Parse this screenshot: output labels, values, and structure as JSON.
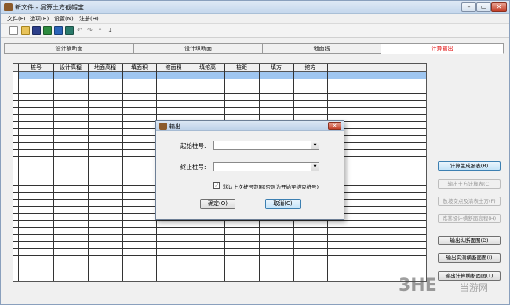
{
  "window": {
    "title": "新文件 - 易算土方截帽宝"
  },
  "menu": [
    {
      "label": "文件(F)"
    },
    {
      "label": "选项(B)"
    },
    {
      "label": "设置(N)"
    },
    {
      "label": "注册(H)"
    }
  ],
  "toolbar": {
    "icons": [
      "new-file-icon",
      "open-folder-icon",
      "save-icon",
      "excel-icon",
      "word-icon",
      "calculator-icon",
      "undo-icon",
      "redo-icon",
      "move-up-icon",
      "move-down-icon"
    ]
  },
  "tabs": [
    {
      "label": "设计横断面"
    },
    {
      "label": "设计纵断面"
    },
    {
      "label": "地面线"
    },
    {
      "label": "计算输出"
    }
  ],
  "grid": {
    "columns": [
      "桩号",
      "设计高程",
      "地面高程",
      "填面积",
      "挖面积",
      "填挖高",
      "桩距",
      "填方",
      "挖方"
    ]
  },
  "side_buttons": [
    {
      "label": "计算生成报表(B)"
    },
    {
      "label": "输出土方计算表(C)"
    },
    {
      "label": "放坡交点及清表土方(F)"
    },
    {
      "label": "路基设计横断面高程(H)"
    },
    {
      "label": "输出纵断面图(D)"
    },
    {
      "label": "输出实测横断面图(I)"
    },
    {
      "label": "输出计算横断面图(T)"
    }
  ],
  "dialog": {
    "title": "输出",
    "start_label": "起始桩号:",
    "start_value": "",
    "end_label": "终止桩号:",
    "end_value": "",
    "checkbox_label": "默认上次桩号范围(否则为开始至结束桩号)",
    "checkbox_checked": true,
    "ok_label": "确定(O)",
    "cancel_label": "取消(C)"
  },
  "watermark": {
    "text": "3HE",
    "sub": "当游网"
  },
  "colors": {
    "active_tab": "#e00000",
    "selected_row": "#9fc6f0"
  }
}
